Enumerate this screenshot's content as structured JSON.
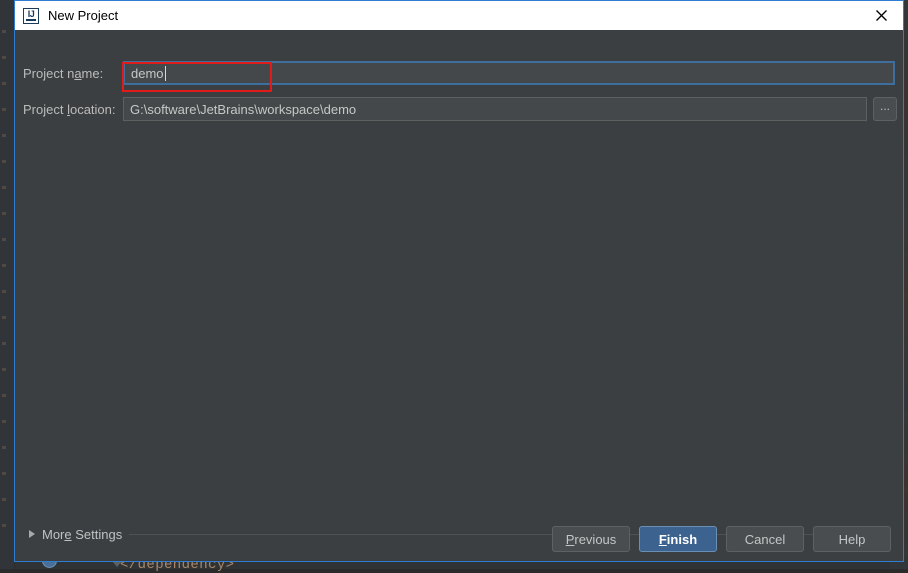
{
  "window": {
    "title": "New Project",
    "icon": "intellij-idea-logo-icon",
    "icon_text": "IJ",
    "close_icon": "close-icon",
    "border_color": "#2d7dd2",
    "titlebar_bg": "#ffffff",
    "body_bg": "#3c3f41"
  },
  "form": {
    "name_field": {
      "label_before": "Project n",
      "label_mnemonic": "a",
      "label_after": "me:",
      "label_full": "Project name:",
      "value": "demo",
      "placeholder": "",
      "focused": true
    },
    "location_field": {
      "label_before": "Project ",
      "label_mnemonic": "l",
      "label_after": "ocation:",
      "label_full": "Project location:",
      "value": "G:\\software\\JetBrains\\workspace\\demo",
      "placeholder": "",
      "browse_label": "...",
      "browse_icon": "ellipsis-icon"
    }
  },
  "annotation": {
    "color": "#e01b1b",
    "target": "project-name-input"
  },
  "more_settings": {
    "label_before": "Mor",
    "label_mnemonic": "e",
    "label_after": " Settings",
    "label_full": "More Settings",
    "expanded": false,
    "disclosure_icon": "chevron-right-icon"
  },
  "buttons": [
    {
      "name": "previous-button",
      "before": "",
      "mnemonic": "P",
      "after": "revious",
      "full": "Previous",
      "default": false
    },
    {
      "name": "finish-button",
      "before": "",
      "mnemonic": "F",
      "after": "inish",
      "full": "Finish",
      "default": true
    },
    {
      "name": "cancel-button",
      "before": "Cancel",
      "mnemonic": "",
      "after": "",
      "full": "Cancel",
      "default": false
    },
    {
      "name": "help-button",
      "before": "Help",
      "mnemonic": "",
      "after": "",
      "full": "Help",
      "default": false
    }
  ],
  "background": {
    "code_line": "</dependency>"
  }
}
